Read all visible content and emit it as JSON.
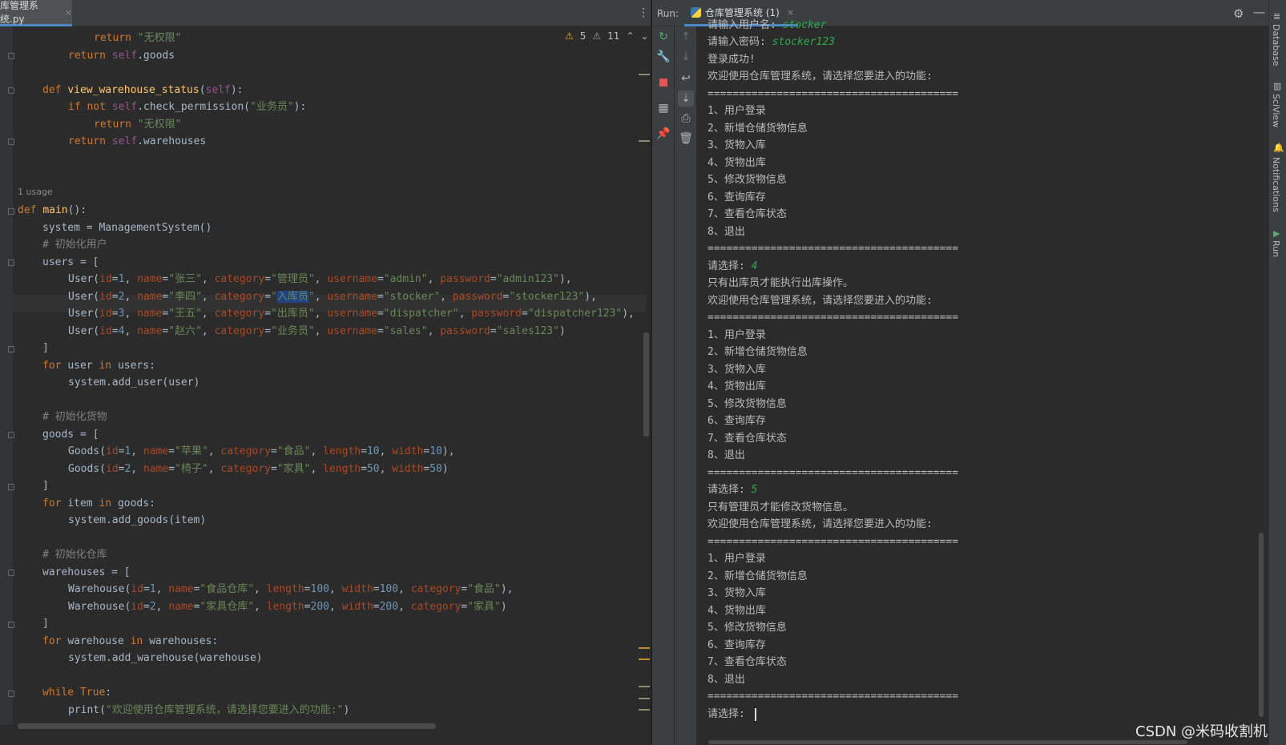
{
  "editor": {
    "tab": {
      "name": "库管理系统.py",
      "close": "×"
    },
    "inspections": {
      "warnings": "5",
      "weak_warnings": "11"
    },
    "usage_hint": "1 usage"
  },
  "code": {
    "l1_return": "return ",
    "l1_str": "\"无权限\"",
    "l2_return": "return ",
    "l2_self": "self",
    "l2_rest": ".goods",
    "l4_def": "def ",
    "l4_fn": "view_warehouse_status",
    "l4_open": "(",
    "l4_self": "self",
    "l4_close": "):",
    "l5_if": "if not ",
    "l5_self": "self",
    "l5_mid": ".check_permission(",
    "l5_str": "\"业务员\"",
    "l5_end": "):",
    "l6_return": "return ",
    "l6_str": "\"无权限\"",
    "l7_return": "return ",
    "l7_self": "self",
    "l7_rest": ".warehouses",
    "main_def": "def ",
    "main_fn": "main",
    "main_rest": "():",
    "system": "system = ManagementSystem()",
    "c_users": "# 初始化用户",
    "users_open": "users = [",
    "u1": {
      "a": "User(",
      "id": "id",
      "eq1": "=",
      "v1": "1",
      ", ": ", ",
      "name": "name",
      "eq2": "=",
      "v2": "\"张三\"",
      "cat": "category",
      "v3": "\"管理员\"",
      "un": "username",
      "v4": "\"admin\"",
      "pw": "password",
      "v5": "\"admin123\"",
      "end": "),"
    },
    "u2": {
      "a": "User(",
      "id": "id",
      "v1": "2",
      "name": "name",
      "v2": "\"李四\"",
      "cat": "category",
      "q": "\"",
      "sel": "入库员",
      "un": "username",
      "v4": "\"stocker\"",
      "pw": "password",
      "v5": "\"stocker123\"",
      "end": "),"
    },
    "u3": {
      "a": "User(",
      "id": "id",
      "v1": "3",
      "name": "name",
      "v2": "\"王五\"",
      "cat": "category",
      "v3": "\"出库员\"",
      "un": "username",
      "v4": "\"dispatcher\"",
      "pw": "password",
      "v5": "\"dispatcher123\"",
      "end": "),"
    },
    "u4": {
      "a": "User(",
      "id": "id",
      "v1": "4",
      "name": "name",
      "v2": "\"赵六\"",
      "cat": "category",
      "v3": "\"业务员\"",
      "un": "username",
      "v4": "\"sales\"",
      "pw": "password",
      "v5": "\"sales123\"",
      "end": ")"
    },
    "bracket": "]",
    "for_kw": "for ",
    "for_user": "user ",
    "in_kw": "in ",
    "for_users": "users:",
    "add_user": "system.add_user(user)",
    "c_goods": "# 初始化货物",
    "goods_open": "goods = [",
    "g1": {
      "a": "Goods(",
      "id": "id",
      "v1": "1",
      "name": "name",
      "v2": "\"苹果\"",
      "cat": "category",
      "v3": "\"食品\"",
      "len": "length",
      "v4": "10",
      "wid": "width",
      "v5": "10",
      "end": "),"
    },
    "g2": {
      "a": "Goods(",
      "id": "id",
      "v1": "2",
      "name": "name",
      "v2": "\"椅子\"",
      "cat": "category",
      "v3": "\"家具\"",
      "len": "length",
      "v4": "50",
      "wid": "width",
      "v5": "50",
      "end": ")"
    },
    "for_item": "item ",
    "for_goods": "goods:",
    "add_goods": "system.add_goods(item)",
    "c_wh": "# 初始化仓库",
    "wh_open": "warehouses = [",
    "w1": {
      "a": "Warehouse(",
      "id": "id",
      "v1": "1",
      "name": "name",
      "v2": "\"食品仓库\"",
      "len": "length",
      "v3": "100",
      "wid": "width",
      "v4": "100",
      "cat": "category",
      "v5": "\"食品\"",
      "end": "),"
    },
    "w2": {
      "a": "Warehouse(",
      "id": "id",
      "v1": "2",
      "name": "name",
      "v2": "\"家具仓库\"",
      "len": "length",
      "v3": "200",
      "wid": "width",
      "v4": "200",
      "cat": "category",
      "v5": "\"家具\"",
      "end": ")"
    },
    "for_wh": "warehouse ",
    "for_whs": "warehouses:",
    "add_wh": "system.add_warehouse(warehouse)",
    "while_kw": "while ",
    "true_kw": "True",
    "colon": ":",
    "print_a": "print(",
    "print_str": "\"欢迎使用仓库管理系统，请选择您要进入的功能:\"",
    "print_end": ")"
  },
  "run": {
    "label": "Run:",
    "tab": "仓库管理系统 (1)",
    "close": "×"
  },
  "console": {
    "user_prompt": "请输入用户名: ",
    "user_value": "stocker",
    "pwd_prompt": "请输入密码: ",
    "pwd_value": "stocker123",
    "login_ok": "登录成功!",
    "welcome": "欢迎使用仓库管理系统，请选择您要进入的功能:",
    "separator": "========================================",
    "menu": [
      "1、用户登录",
      "2、新增仓储货物信息",
      "3、货物入库",
      "4、货物出库",
      "5、修改货物信息",
      "6、查询库存",
      "7、查看仓库状态",
      "8、退出"
    ],
    "choose_prompt": "请选择: ",
    "choice1": "4",
    "msg1": "只有出库员才能执行出库操作。",
    "choice2": "5",
    "msg2": "只有管理员才能修改货物信息。"
  },
  "side_tools": {
    "database": "Database",
    "sciview": "SciView",
    "notifications": "Notifications",
    "run": "Run"
  },
  "watermark": "CSDN @米码收割机"
}
